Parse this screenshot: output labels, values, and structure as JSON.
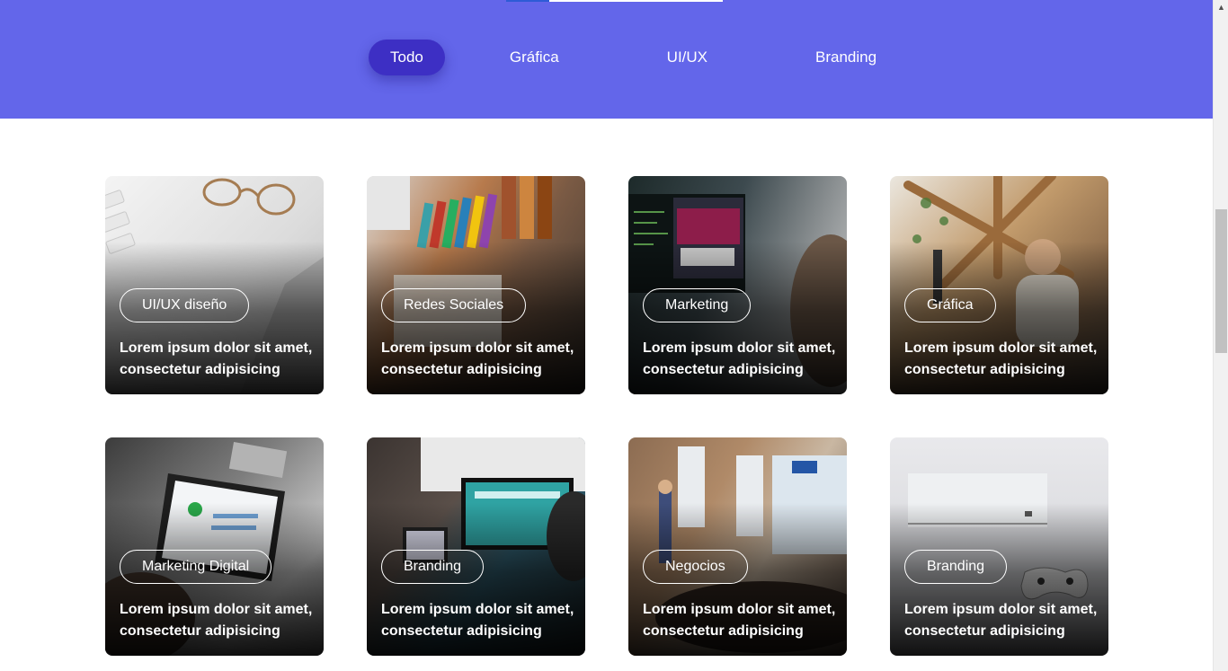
{
  "filters": {
    "tabs": [
      {
        "label": "Todo",
        "active": true
      },
      {
        "label": "Gráfica",
        "active": false
      },
      {
        "label": "UI/UX",
        "active": false
      },
      {
        "label": "Branding",
        "active": false
      }
    ]
  },
  "portfolio": {
    "items": [
      {
        "tag": "UI/UX diseño",
        "text": "Lorem ipsum dolor sit amet, consectetur adipisicing",
        "image": "desk-glasses-keyboard"
      },
      {
        "tag": "Redes Sociales",
        "text": "Lorem ipsum dolor sit amet, consectetur adipisicing",
        "image": "desk-books"
      },
      {
        "tag": "Marketing",
        "text": "Lorem ipsum dolor sit amet, consectetur adipisicing",
        "image": "person-at-monitor"
      },
      {
        "tag": "Gráfica",
        "text": "Lorem ipsum dolor sit amet, consectetur adipisicing",
        "image": "podcast-studio"
      },
      {
        "tag": "Marketing Digital",
        "text": "Lorem ipsum dolor sit amet, consectetur adipisicing",
        "image": "laptop-analytics"
      },
      {
        "tag": "Branding",
        "text": "Lorem ipsum dolor sit amet, consectetur adipisicing",
        "image": "meeting-screens"
      },
      {
        "tag": "Negocios",
        "text": "Lorem ipsum dolor sit amet, consectetur adipisicing",
        "image": "presentation-brick-room"
      },
      {
        "tag": "Branding",
        "text": "Lorem ipsum dolor sit amet, consectetur adipisicing",
        "image": "game-console"
      }
    ]
  },
  "colors": {
    "hero_bg": "#6366ea",
    "active_tab_bg": "#3d2fc4",
    "text_on_dark": "#ffffff"
  },
  "scrollbar": {
    "up_icon": "arrow-up-icon"
  }
}
